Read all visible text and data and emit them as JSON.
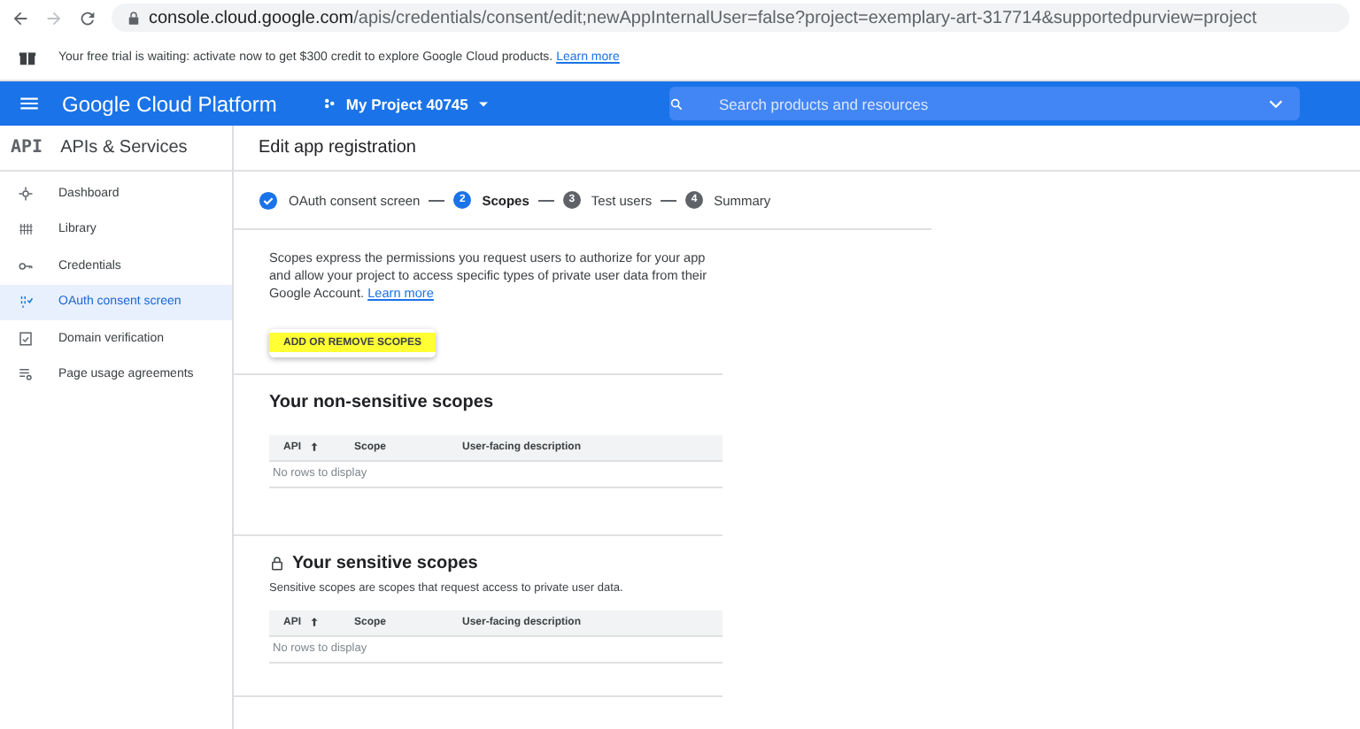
{
  "browser": {
    "url_host": "console.cloud.google.com",
    "url_path": "/apis/credentials/consent/edit;newAppInternalUser=false?project=exemplary-art-317714&supportedpurview=project"
  },
  "banner": {
    "text": "Your free trial is waiting: activate now to get $300 credit to explore Google Cloud products.",
    "link": "Learn more"
  },
  "topbar": {
    "product": "Google Cloud Platform",
    "project": "My Project 40745",
    "search": {
      "placeholder": "Search products and resources"
    }
  },
  "sidebar": {
    "badge": "API",
    "title": "APIs & Services",
    "items": [
      {
        "label": "Dashboard",
        "selected": false
      },
      {
        "label": "Library",
        "selected": false
      },
      {
        "label": "Credentials",
        "selected": false
      },
      {
        "label": "OAuth consent screen",
        "selected": true
      },
      {
        "label": "Domain verification",
        "selected": false
      },
      {
        "label": "Page usage agreements",
        "selected": false
      }
    ]
  },
  "main": {
    "title": "Edit app registration",
    "steps": [
      {
        "label": "OAuth consent screen",
        "completed": true,
        "selected": false
      },
      {
        "number": "2",
        "label": "Scopes",
        "completed": false,
        "selected": true
      },
      {
        "number": "3",
        "label": "Test users",
        "completed": false,
        "selected": false
      },
      {
        "number": "4",
        "label": "Summary",
        "completed": false,
        "selected": false
      }
    ],
    "intro": "Scopes express the permissions you request users to authorize for your app and allow your project to access specific types of private user data from their Google Account.",
    "intro_link": "Learn more",
    "button": {
      "label": "ADD OR REMOVE SCOPES",
      "highlighted": true
    },
    "sections": [
      {
        "title": "Your non-sensitive scopes",
        "locked": false,
        "columns": [
          "API",
          "Scope",
          "User-facing description"
        ],
        "empty": "No rows to display"
      },
      {
        "title": "Your sensitive scopes",
        "locked": true,
        "subtitle": "Sensitive scopes are scopes that request access to private user data.",
        "columns": [
          "API",
          "Scope",
          "User-facing description"
        ],
        "empty": "No rows to display"
      }
    ]
  }
}
